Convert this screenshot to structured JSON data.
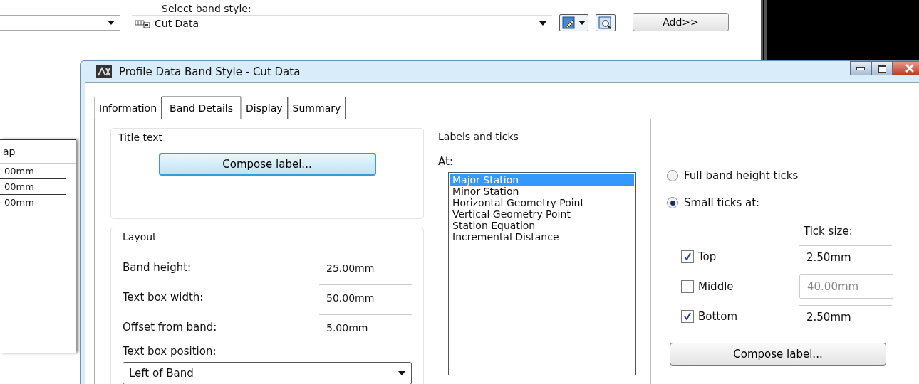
{
  "band_style": {
    "label": "Select band style:",
    "value": "Cut Data"
  },
  "add_button": "Add>>",
  "background_table": {
    "header": "ap",
    "rows": [
      "00mm",
      "00mm",
      "00mm"
    ]
  },
  "dialog": {
    "title": "Profile Data Band Style - Cut Data",
    "tabs": [
      {
        "label": "Information",
        "selected": false
      },
      {
        "label": "Band Details",
        "selected": true
      },
      {
        "label": "Display",
        "selected": false
      },
      {
        "label": "Summary",
        "selected": false
      }
    ],
    "title_text": {
      "heading": "Title text",
      "button": "Compose label..."
    },
    "layout": {
      "heading": "Layout",
      "fields": [
        {
          "label": "Band height:",
          "value": "25.00mm"
        },
        {
          "label": "Text box width:",
          "value": "50.00mm"
        },
        {
          "label": "Offset from band:",
          "value": "5.00mm"
        }
      ],
      "position": {
        "label": "Text box position:",
        "value": "Left of Band"
      }
    },
    "labels_and_ticks": {
      "heading": "Labels and ticks",
      "at_label": "At:",
      "stations": [
        {
          "label": "Major Station",
          "selected": true
        },
        {
          "label": "Minor Station",
          "selected": false
        },
        {
          "label": "Horizontal Geometry Point",
          "selected": false
        },
        {
          "label": "Vertical Geometry Point",
          "selected": false
        },
        {
          "label": "Station Equation",
          "selected": false
        },
        {
          "label": "Incremental Distance",
          "selected": false
        }
      ],
      "tick_modes": [
        {
          "label": "Full band height ticks",
          "selected": false
        },
        {
          "label": "Small ticks at:",
          "selected": true
        }
      ],
      "tick_size_label": "Tick size:",
      "ticks": [
        {
          "label": "Top",
          "checked": true,
          "value": "2.50mm"
        },
        {
          "label": "Middle",
          "checked": false,
          "value": "40.00mm"
        },
        {
          "label": "Bottom",
          "checked": true,
          "value": "2.50mm"
        }
      ],
      "button": "Compose label..."
    }
  }
}
